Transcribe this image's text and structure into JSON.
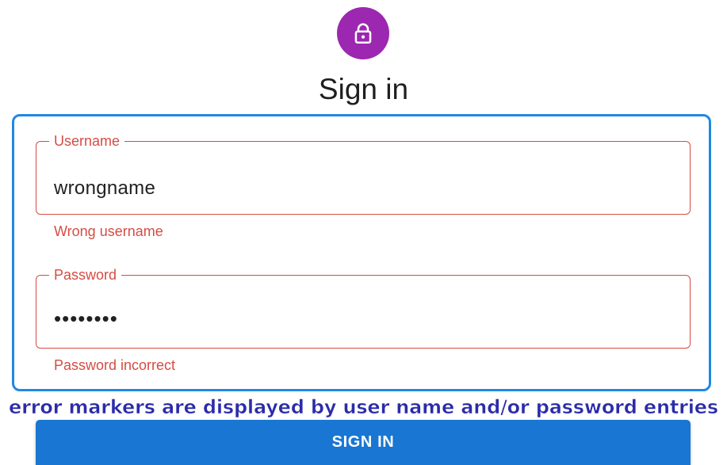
{
  "header": {
    "icon": "lock-icon",
    "avatar_color": "#9c27b0",
    "title": "Sign in"
  },
  "form": {
    "username": {
      "label": "Username",
      "value": "wrongname",
      "error": "Wrong username"
    },
    "password": {
      "label": "Password",
      "masked_value": "••••••••",
      "error": "Password incorrect"
    },
    "error_color": "#d64c44",
    "highlight_color": "#1e88e5"
  },
  "annotation": "error markers are displayed by user name and/or password entries",
  "submit": {
    "label": "SIGN IN",
    "color": "#1976d2"
  }
}
